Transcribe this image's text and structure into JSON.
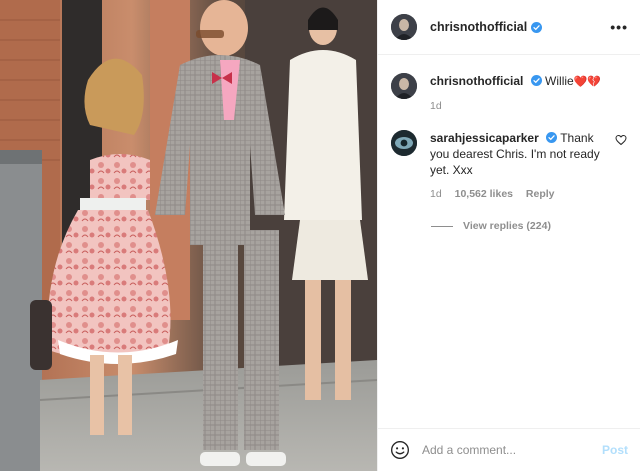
{
  "photo": {
    "alt_icon": "street-photo"
  },
  "header": {
    "username": "chrisnothofficial",
    "more_icon": "more-horizontal-icon",
    "more_label": "•••"
  },
  "caption": {
    "username": "chrisnothofficial",
    "text": "Willie",
    "emoji": "❤️💔",
    "time": "1d"
  },
  "comment": {
    "username": "sarahjessicaparker",
    "text": "Thank you dearest Chris. I'm not ready yet. Xxx",
    "time": "1d",
    "likes": "10,562 likes",
    "reply_label": "Reply",
    "view_replies": "View replies (224)"
  },
  "add_comment": {
    "placeholder": "Add a comment...",
    "post_label": "Post"
  },
  "colors": {
    "verified": "#3897f0",
    "post_disabled": "#b2dffc",
    "muted": "#8e8e8e"
  }
}
